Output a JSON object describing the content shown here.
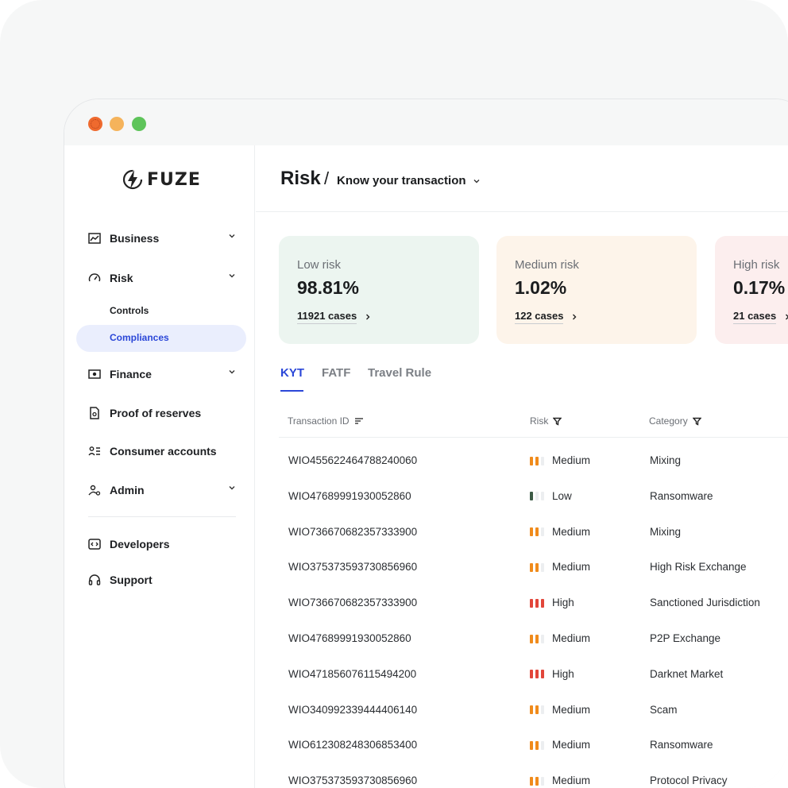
{
  "brand": {
    "name": "FUZE"
  },
  "colors": {
    "accent": "#2b47d8",
    "low": "#3c5a45",
    "medium": "#f08b1c",
    "high": "#e2463a",
    "empty": "#eceef0"
  },
  "sidebar": {
    "items": [
      {
        "label": "Business",
        "icon": "chart-icon",
        "chevron": true
      },
      {
        "label": "Risk",
        "icon": "gauge-icon",
        "chevron": true
      },
      {
        "label": "Finance",
        "icon": "cash-icon",
        "chevron": true
      },
      {
        "label": "Proof of reserves",
        "icon": "document-icon",
        "chevron": false
      },
      {
        "label": "Consumer accounts",
        "icon": "users-list-icon",
        "chevron": false
      },
      {
        "label": "Admin",
        "icon": "user-gear-icon",
        "chevron": true
      },
      {
        "label": "Developers",
        "icon": "code-icon",
        "chevron": false
      },
      {
        "label": "Support",
        "icon": "headset-icon",
        "chevron": false
      }
    ],
    "risk_sub": [
      {
        "label": "Controls"
      },
      {
        "label": "Compliances"
      }
    ]
  },
  "header": {
    "title": "Risk",
    "separator": "/",
    "subtitle": "Know your transaction"
  },
  "cards": [
    {
      "label": "Low risk",
      "value": "98.81%",
      "cases": "11921 cases"
    },
    {
      "label": "Medium risk",
      "value": "1.02%",
      "cases": "122 cases"
    },
    {
      "label": "High risk",
      "value": "0.17%",
      "cases": "21 cases"
    }
  ],
  "tabs": [
    "KYT",
    "FATF",
    "Travel Rule"
  ],
  "table": {
    "columns": [
      "Transaction ID",
      "Risk",
      "Category"
    ],
    "rows": [
      {
        "id": "WIO455622464788240060",
        "risk": "Medium",
        "level": 2,
        "category": "Mixing"
      },
      {
        "id": "WIO47689991930052860",
        "risk": "Low",
        "level": 1,
        "category": "Ransomware"
      },
      {
        "id": "WIO736670682357333900",
        "risk": "Medium",
        "level": 2,
        "category": "Mixing"
      },
      {
        "id": "WIO375373593730856960",
        "risk": "Medium",
        "level": 2,
        "category": "High Risk Exchange"
      },
      {
        "id": "WIO736670682357333900",
        "risk": "High",
        "level": 3,
        "category": "Sanctioned Jurisdiction"
      },
      {
        "id": "WIO47689991930052860",
        "risk": "Medium",
        "level": 2,
        "category": "P2P Exchange"
      },
      {
        "id": "WIO471856076115494200",
        "risk": "High",
        "level": 3,
        "category": "Darknet Market"
      },
      {
        "id": "WIO340992339444406140",
        "risk": "Medium",
        "level": 2,
        "category": "Scam"
      },
      {
        "id": "WIO612308248306853400",
        "risk": "Medium",
        "level": 2,
        "category": "Ransomware"
      },
      {
        "id": "WIO375373593730856960",
        "risk": "Medium",
        "level": 2,
        "category": "Protocol Privacy"
      }
    ]
  }
}
